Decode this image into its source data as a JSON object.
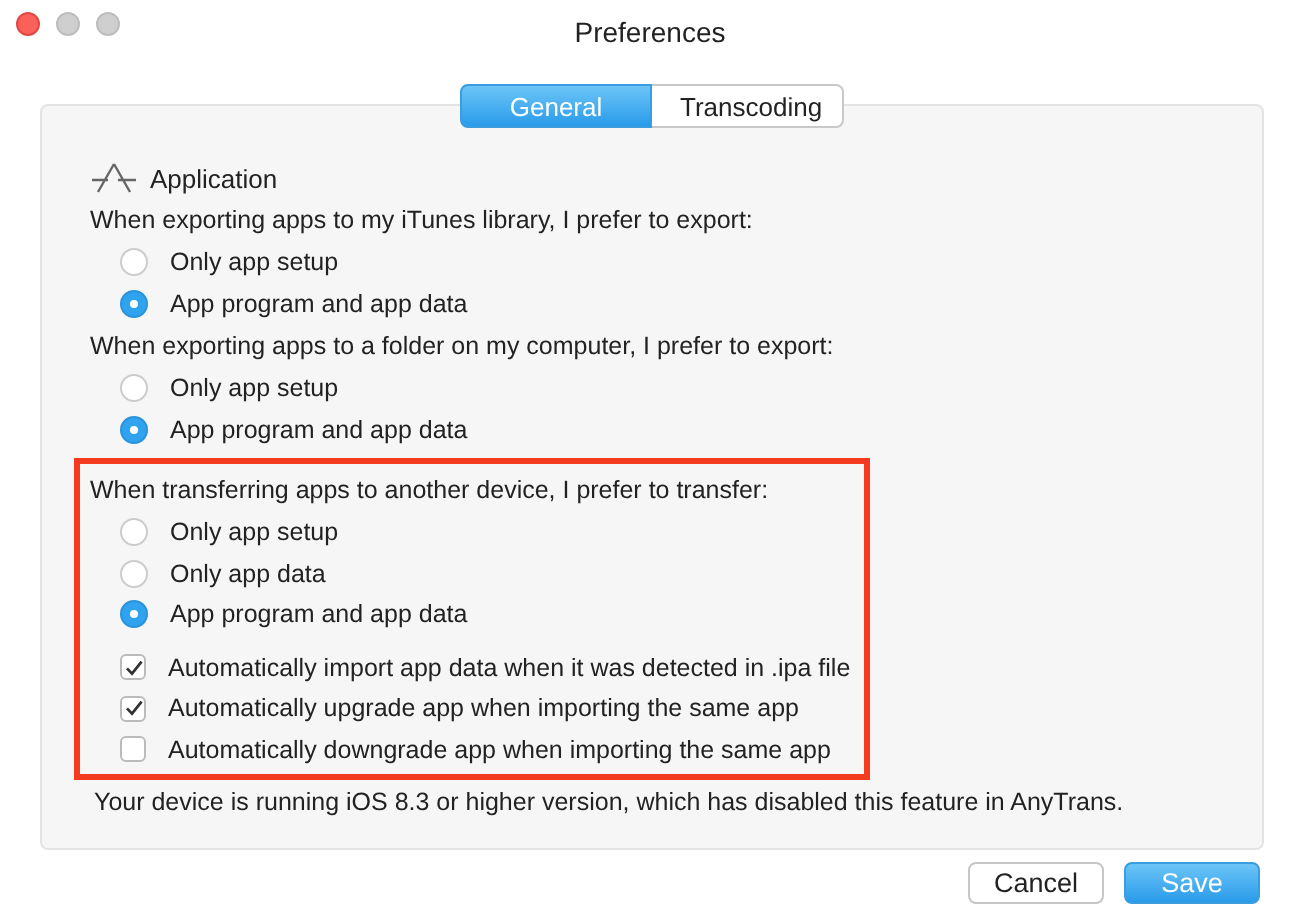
{
  "window": {
    "title": "Preferences"
  },
  "tabs": [
    {
      "label": "General",
      "selected": true
    },
    {
      "label": "Transcoding",
      "selected": false
    }
  ],
  "section": {
    "title": "Application"
  },
  "groups": [
    {
      "question": "When exporting apps to my iTunes library, I prefer to export:",
      "highlighted": false,
      "options": [
        {
          "kind": "radio",
          "label": "Only app setup",
          "selected": false
        },
        {
          "kind": "radio",
          "label": "App program and app data",
          "selected": true
        }
      ]
    },
    {
      "question": "When exporting apps to a folder on my computer, I prefer to export:",
      "highlighted": false,
      "options": [
        {
          "kind": "radio",
          "label": "Only app setup",
          "selected": false
        },
        {
          "kind": "radio",
          "label": "App program and app data",
          "selected": true
        }
      ]
    },
    {
      "question": "When transferring apps to another device, I prefer to transfer:",
      "highlighted": true,
      "options": [
        {
          "kind": "radio",
          "label": "Only app setup",
          "selected": false
        },
        {
          "kind": "radio",
          "label": "Only app data",
          "selected": false
        },
        {
          "kind": "radio",
          "label": "App program and app data",
          "selected": true
        },
        {
          "kind": "checkbox",
          "label": "Automatically import app data when it was detected in .ipa file",
          "checked": true
        },
        {
          "kind": "checkbox",
          "label": "Automatically upgrade app when importing the same app",
          "checked": true
        },
        {
          "kind": "checkbox",
          "label": "Automatically downgrade app when importing the same app",
          "checked": false
        }
      ]
    }
  ],
  "note": "Your device is running iOS 8.3 or higher version, which has disabled this feature in AnyTrans.",
  "buttons": [
    {
      "label": "Cancel",
      "kind": "secondary"
    },
    {
      "label": "Save",
      "kind": "primary"
    }
  ]
}
